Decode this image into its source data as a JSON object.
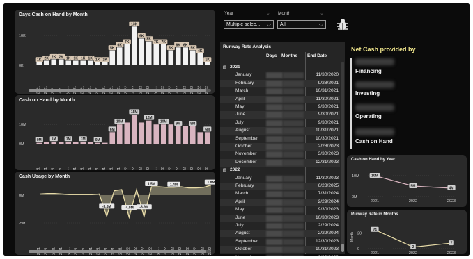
{
  "colors": {
    "accent_gold": "#e8dca8",
    "bar_white": "#f2f2f2",
    "bar_pink": "#d9b5c0",
    "net_title": "#f0e68c"
  },
  "months": [
    "Jan 2021",
    "Feb 2021",
    "Mar 2021",
    "Apr 2021",
    "May 2...",
    "Jun 2021",
    "Jul 2021",
    "Aug 2021",
    "Sep 2021",
    "Oct 2021",
    "Nov 2021",
    "Dec 2021",
    "Jan 2022",
    "Feb 2022",
    "Mar 2022",
    "Apr 2022",
    "May 2...",
    "Jun 2022",
    "Jul 2022",
    "Aug 2022",
    "Sep 2022",
    "Oct 2022",
    "Nov 2022",
    "Dec 2022"
  ],
  "days_chart": {
    "title": "Days Cash on Hand by Month",
    "ylim": [
      0,
      14000
    ],
    "ytick_labels": [
      "10K",
      "0K"
    ],
    "values": [
      1000,
      1500,
      2000,
      2000,
      1500,
      1500,
      1500,
      1500,
      1000,
      1000,
      5000,
      6000,
      7000,
      13000,
      9000,
      8000,
      7000,
      7000,
      5000,
      6000,
      6000,
      5000,
      4000,
      1000
    ],
    "labels": [
      "1K",
      "2K",
      "2K",
      "2K",
      "1K",
      "1K",
      "1K",
      "1K",
      "1K",
      "1K",
      "5K",
      "6K",
      "7K",
      "13K",
      "9K",
      "8K",
      "7K",
      "7K",
      "5K",
      "6K",
      "6K",
      "5K",
      "4K",
      "1K"
    ]
  },
  "cash_chart": {
    "title": "Cash on Hand by Month",
    "ylim": [
      0,
      18
    ],
    "ytick_labels": [
      "10M",
      "0M"
    ],
    "values": [
      0.5,
      1,
      1,
      1,
      1,
      1,
      1,
      1,
      0.5,
      0.5,
      6,
      10,
      11,
      15,
      11,
      12,
      10,
      10,
      10,
      9,
      9,
      9,
      6,
      6
    ],
    "labels": [
      "0M",
      "",
      "1M",
      "",
      "1M",
      "",
      "1M",
      "",
      "0M",
      "",
      "6M",
      "10M",
      "",
      "15M",
      "",
      "12M",
      "",
      "10M",
      "",
      "9M",
      "",
      "9M",
      "",
      "6M"
    ]
  },
  "usage_chart": {
    "title": "Cash Usage by Month",
    "ylim": [
      -6,
      2
    ],
    "ytick_labels": [
      "0M",
      "-5M"
    ],
    "values": [
      0.2,
      0.3,
      0.3,
      0.2,
      0.1,
      0.1,
      0.1,
      0.1,
      0.2,
      -3.8,
      0.8,
      1.0,
      -4.0,
      1.0,
      -3.9,
      1.5,
      1.5,
      1.4,
      1.4,
      1.5,
      1.3,
      1.3,
      1.4,
      1.8
    ],
    "labels": [
      "",
      "",
      "",
      "",
      "",
      "",
      "",
      "",
      "",
      "-3.8M",
      "",
      "",
      "-4.0M",
      "",
      "-3.9M",
      "1.5M",
      "",
      "",
      "1.4M",
      "",
      "",
      "",
      "",
      "1.8M"
    ]
  },
  "slicers": {
    "year_label": "Year",
    "year_value": "Multiple selec...",
    "month_label": "Month",
    "month_value": "All"
  },
  "matrix": {
    "title": "Runway Rate Analysis",
    "headers": [
      "Days",
      "Months",
      "End Date"
    ],
    "groups": [
      {
        "year": "2021",
        "rows": [
          [
            "January",
            "11/30/2020"
          ],
          [
            "February",
            "9/28/2021"
          ],
          [
            "March",
            "10/31/2021"
          ],
          [
            "April",
            "11/30/2021"
          ],
          [
            "May",
            "9/30/2021"
          ],
          [
            "June",
            "9/30/2021"
          ],
          [
            "July",
            "9/30/2021"
          ],
          [
            "August",
            "10/31/2021"
          ],
          [
            "September",
            "10/30/2021"
          ],
          [
            "October",
            "2/28/2023"
          ],
          [
            "November",
            "3/30/2023"
          ],
          [
            "December",
            "12/31/2023"
          ]
        ]
      },
      {
        "year": "2022",
        "rows": [
          [
            "January",
            "11/30/2023"
          ],
          [
            "February",
            "6/28/2025"
          ],
          [
            "March",
            "7/31/2024"
          ],
          [
            "April",
            "2/29/2024"
          ],
          [
            "May",
            "9/30/2023"
          ],
          [
            "June",
            "10/30/2023"
          ],
          [
            "July",
            "2/29/2024"
          ],
          [
            "August",
            "2/29/2024"
          ],
          [
            "September",
            "12/30/2023"
          ],
          [
            "October",
            "10/31/2023"
          ],
          [
            "November",
            "9/30/2023"
          ],
          [
            "December",
            "2/28/2023"
          ]
        ]
      }
    ]
  },
  "net_cash": {
    "title": "Net Cash provided by",
    "items": [
      "Financing",
      "Investing",
      "Operating",
      "Cash on Hand"
    ]
  },
  "cash_by_year": {
    "title": "Cash on Hand by Year",
    "ytick_labels": [
      "10M",
      "0M"
    ],
    "ylim": [
      0,
      14
    ],
    "categories": [
      "2021",
      "2022",
      "2023"
    ],
    "values": [
      10,
      5,
      4
    ],
    "labels": [
      "10M",
      "5M",
      "4M"
    ]
  },
  "runway_months": {
    "title": "Runway Rate in Months",
    "ylabel": "Month",
    "ytick_labels": [
      "20",
      "0"
    ],
    "ylim": [
      0,
      30
    ],
    "categories": [
      "2021",
      "2022",
      "2023"
    ],
    "values": [
      24,
      2,
      7
    ],
    "labels": [
      "24",
      "2",
      "7"
    ]
  },
  "chart_data": [
    {
      "type": "bar",
      "title": "Days Cash on Hand by Month",
      "categories_ref": "months",
      "values": [
        1000,
        1500,
        2000,
        2000,
        1500,
        1500,
        1500,
        1500,
        1000,
        1000,
        5000,
        6000,
        7000,
        13000,
        9000,
        8000,
        7000,
        7000,
        5000,
        6000,
        6000,
        5000,
        4000,
        1000
      ]
    },
    {
      "type": "bar",
      "title": "Cash on Hand by Month",
      "values": [
        0.5,
        1,
        1,
        1,
        1,
        1,
        1,
        1,
        0.5,
        0.5,
        6,
        10,
        11,
        15,
        11,
        12,
        10,
        10,
        10,
        9,
        9,
        9,
        6,
        6
      ]
    },
    {
      "type": "area",
      "title": "Cash Usage by Month",
      "values": [
        0.2,
        0.3,
        0.3,
        0.2,
        0.1,
        0.1,
        0.1,
        0.1,
        0.2,
        -3.8,
        0.8,
        1.0,
        -4.0,
        1.0,
        -3.9,
        1.5,
        1.5,
        1.4,
        1.4,
        1.5,
        1.3,
        1.3,
        1.4,
        1.8
      ]
    },
    {
      "type": "line",
      "title": "Cash on Hand by Year",
      "categories": [
        "2021",
        "2022",
        "2023"
      ],
      "values": [
        10,
        5,
        4
      ]
    },
    {
      "type": "line",
      "title": "Runway Rate in Months",
      "categories": [
        "2021",
        "2022",
        "2023"
      ],
      "values": [
        24,
        2,
        7
      ]
    }
  ]
}
